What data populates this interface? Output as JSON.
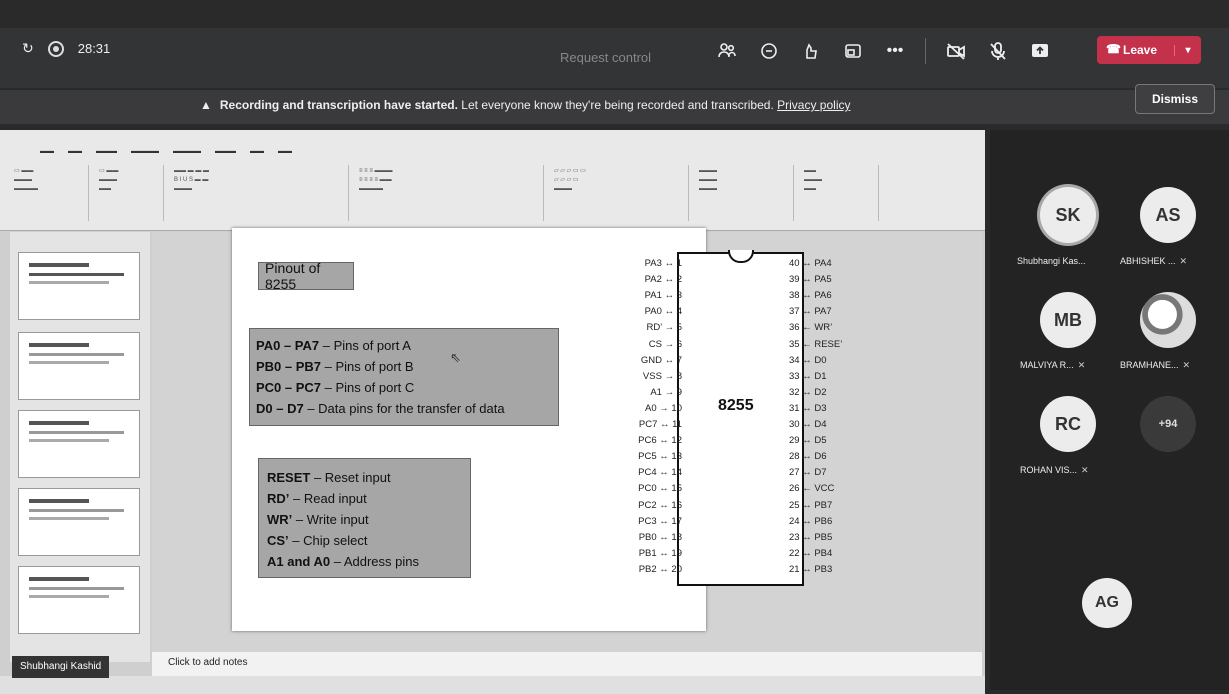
{
  "top_bar": {
    "timer": "28:31",
    "request_control": "Request control",
    "leave_label": "Leave"
  },
  "banner": {
    "bold": "Recording and transcription have started.",
    "text": "Let everyone know they're being recorded and transcribed.",
    "link": "Privacy policy",
    "dismiss": "Dismiss"
  },
  "slide": {
    "title_box": "Pinout of 8255",
    "ports": [
      {
        "term": "PA0 – PA7",
        "desc": " – Pins of port A"
      },
      {
        "term": "PB0 – PB7",
        "desc": " – Pins of port B"
      },
      {
        "term": "PC0 – PC7",
        "desc": " – Pins of port C"
      },
      {
        "term": "D0 – D7",
        "desc": " – Data pins for the transfer of data"
      }
    ],
    "controls": [
      {
        "term": "RESET",
        "desc": " – Reset input"
      },
      {
        "term": "RD’",
        "desc": " – Read input"
      },
      {
        "term": "WR’",
        "desc": " – Write input"
      },
      {
        "term": "CS’",
        "desc": " – Chip select"
      },
      {
        "term": "A1 and A0",
        "desc": " – Address pins"
      }
    ],
    "chip_label": "8255",
    "left_pins": [
      {
        "name": "PA3",
        "arrow": "↔",
        "num": "1"
      },
      {
        "name": "PA2",
        "arrow": "↔",
        "num": "2"
      },
      {
        "name": "PA1",
        "arrow": "↔",
        "num": "3"
      },
      {
        "name": "PA0",
        "arrow": "↔",
        "num": "4"
      },
      {
        "name": "RD’",
        "arrow": "→",
        "num": "5"
      },
      {
        "name": "CS",
        "arrow": "→",
        "num": "6"
      },
      {
        "name": "GND",
        "arrow": "↔",
        "num": "7"
      },
      {
        "name": "VSS",
        "arrow": "→",
        "num": "8"
      },
      {
        "name": "A1",
        "arrow": "→",
        "num": "9"
      },
      {
        "name": "A0",
        "arrow": "→",
        "num": "10"
      },
      {
        "name": "PC7",
        "arrow": "↔",
        "num": "11"
      },
      {
        "name": "PC6",
        "arrow": "↔",
        "num": "12"
      },
      {
        "name": "PC5",
        "arrow": "↔",
        "num": "13"
      },
      {
        "name": "PC4",
        "arrow": "↔",
        "num": "14"
      },
      {
        "name": "PC0",
        "arrow": "↔",
        "num": "15"
      },
      {
        "name": "PC2",
        "arrow": "↔",
        "num": "16"
      },
      {
        "name": "PC3",
        "arrow": "↔",
        "num": "17"
      },
      {
        "name": "PB0",
        "arrow": "↔",
        "num": "18"
      },
      {
        "name": "PB1",
        "arrow": "↔",
        "num": "19"
      },
      {
        "name": "PB2",
        "arrow": "↔",
        "num": "20"
      }
    ],
    "right_pins": [
      {
        "num": "40",
        "arrow": "↔",
        "name": "PA4"
      },
      {
        "num": "39",
        "arrow": "↔",
        "name": "PA5"
      },
      {
        "num": "38",
        "arrow": "↔",
        "name": "PA6"
      },
      {
        "num": "37",
        "arrow": "↔",
        "name": "PA7"
      },
      {
        "num": "36",
        "arrow": "←",
        "name": "WR’"
      },
      {
        "num": "35",
        "arrow": "←",
        "name": "RESE’"
      },
      {
        "num": "34",
        "arrow": "↔",
        "name": "D0"
      },
      {
        "num": "33",
        "arrow": "↔",
        "name": "D1"
      },
      {
        "num": "32",
        "arrow": "↔",
        "name": "D2"
      },
      {
        "num": "31",
        "arrow": "↔",
        "name": "D3"
      },
      {
        "num": "30",
        "arrow": "↔",
        "name": "D4"
      },
      {
        "num": "29",
        "arrow": "↔",
        "name": "D5"
      },
      {
        "num": "28",
        "arrow": "↔",
        "name": "D6"
      },
      {
        "num": "27",
        "arrow": "↔",
        "name": "D7"
      },
      {
        "num": "26",
        "arrow": "←",
        "name": "VCC"
      },
      {
        "num": "25",
        "arrow": "↔",
        "name": "PB7"
      },
      {
        "num": "24",
        "arrow": "↔",
        "name": "PB6"
      },
      {
        "num": "23",
        "arrow": "↔",
        "name": "PB5"
      },
      {
        "num": "22",
        "arrow": "↔",
        "name": "PB4"
      },
      {
        "num": "21",
        "arrow": "↔",
        "name": "PB3"
      }
    ]
  },
  "notes_placeholder": "Click to add notes",
  "presenter_name": "Shubhangi Kashid",
  "participants": [
    {
      "initials": "SK",
      "name": "Shubhangi Kas..."
    },
    {
      "initials": "AS",
      "name": "ABHISHEK ..."
    },
    {
      "initials": "MB",
      "name": "MALVIYA R..."
    },
    {
      "initials": "",
      "name": "BRAMHANE..."
    },
    {
      "initials": "RC",
      "name": "ROHAN VIS..."
    },
    {
      "initials": "+94",
      "name": ""
    },
    {
      "initials": "AG",
      "name": ""
    }
  ]
}
